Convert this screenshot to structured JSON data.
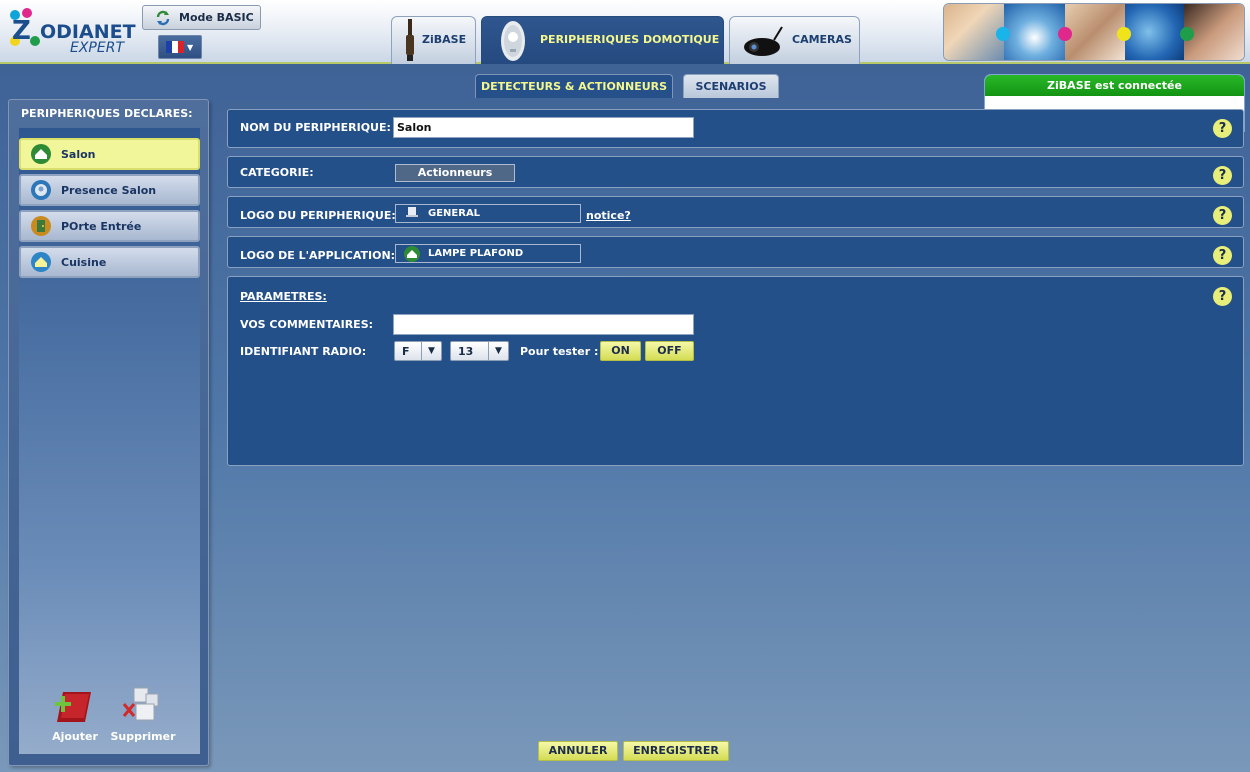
{
  "header": {
    "logo_mark": "Z",
    "logo_line1": "ODIANET",
    "logo_line2": "EXPERT",
    "mode_button": "Mode BASIC",
    "language_flag": "french-flag-icon",
    "tabs": [
      {
        "label": "ZiBASE",
        "active": false,
        "icon": "zibase-icon"
      },
      {
        "label": "PERIPHERIQUES DOMOTIQUE",
        "active": true,
        "icon": "sensor-icon"
      },
      {
        "label": "CAMERAS",
        "active": false,
        "icon": "camera-icon"
      }
    ]
  },
  "subtabs": [
    {
      "label": "DETECTEURS & ACTIONNEURS",
      "active": true
    },
    {
      "label": "SCENARIOS",
      "active": false
    }
  ],
  "status": {
    "text": "ZiBASE est connectée",
    "color": "#1fa81f"
  },
  "sidebar": {
    "title": "PERIPHERIQUES DECLARES:",
    "items": [
      {
        "label": "Salon",
        "selected": true,
        "icon": "house-icon"
      },
      {
        "label": "Presence Salon",
        "selected": false,
        "icon": "motion-sensor-icon"
      },
      {
        "label": "POrte Entrée",
        "selected": false,
        "icon": "door-sensor-icon"
      },
      {
        "label": "Cuisine",
        "selected": false,
        "icon": "house-icon"
      }
    ],
    "add_label": "Ajouter",
    "delete_label": "Supprimer"
  },
  "form": {
    "name_label": "NOM DU PERIPHERIQUE:",
    "name_value": "Salon",
    "category_label": "CATEGORIE:",
    "category_value": "Actionneurs",
    "device_logo_label": "LOGO DU PERIPHERIQUE:",
    "device_logo_value": "GENERAL",
    "notice_link": "notice?",
    "app_logo_label": "LOGO DE L'APPLICATION:",
    "app_logo_value": "LAMPE PLAFOND",
    "params_label": "PARAMETRES:",
    "comments_label": "VOS COMMENTAIRES:",
    "comments_value": "",
    "radio_label": "IDENTIFIANT RADIO:",
    "radio_letter": "F",
    "radio_number": "13",
    "test_label": "Pour tester :",
    "on_label": "ON",
    "off_label": "OFF",
    "help_glyph": "?"
  },
  "footer": {
    "cancel": "ANNULER",
    "save": "ENREGISTRER"
  },
  "colors": {
    "accent_yellow": "#f4f78d",
    "panel_blue": "#24508a",
    "status_green": "#1fa81f"
  }
}
